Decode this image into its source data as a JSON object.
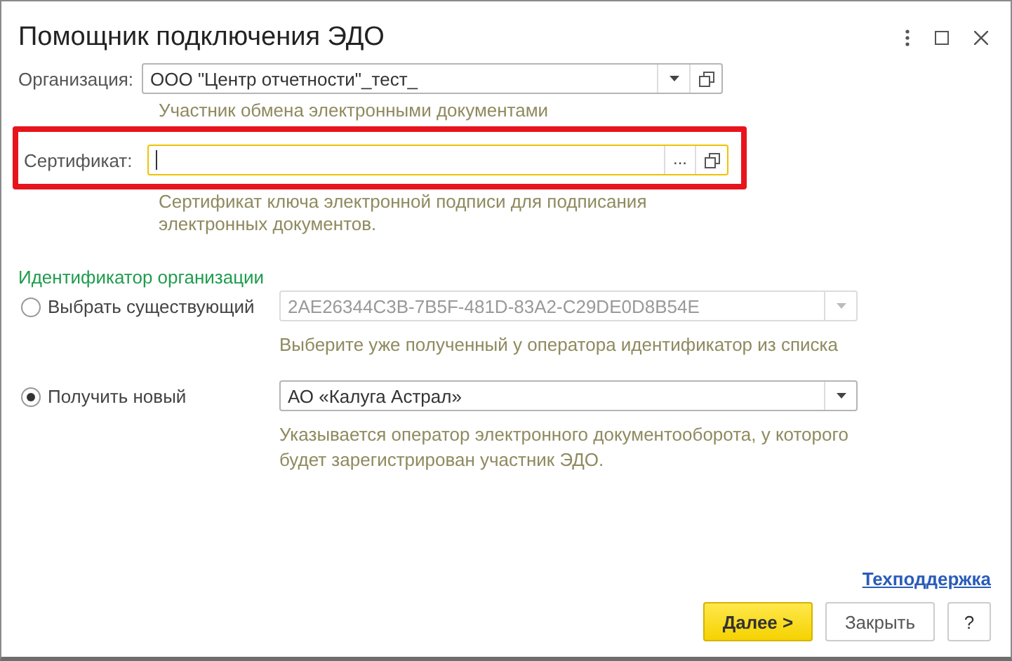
{
  "window": {
    "title": "Помощник подключения ЭДО"
  },
  "organization": {
    "label": "Организация:",
    "value": "ООО \"Центр отчетности\"_тест_",
    "hint": "Участник обмена электронными документами"
  },
  "certificate": {
    "label": "Сертификат:",
    "focused": true,
    "highlighted": true,
    "choose_button": "...",
    "hint": "Сертификат ключа электронной подписи для подписания электронных документов."
  },
  "identifier": {
    "title": "Идентификатор организации",
    "options": [
      {
        "label": "Выбрать существующий",
        "selected": false,
        "value": "2AE26344C3B-7B5F-481D-83A2-C29DE0D8B54E",
        "disabled": true,
        "hint": "Выберите уже полученный у оператора идентификатор из списка"
      },
      {
        "label": "Получить новый",
        "selected": true,
        "value": "АО «Калуга Астрал»",
        "disabled": false,
        "hint": "Указывается оператор электронного документооборота, у которого будет зарегистрирован участник ЭДО."
      }
    ]
  },
  "support_link": "Техподдержка",
  "buttons": [
    {
      "label": "Далее >",
      "kind": "primary"
    },
    {
      "label": "Закрыть",
      "kind": "default"
    },
    {
      "label": "?",
      "kind": "help"
    }
  ]
}
